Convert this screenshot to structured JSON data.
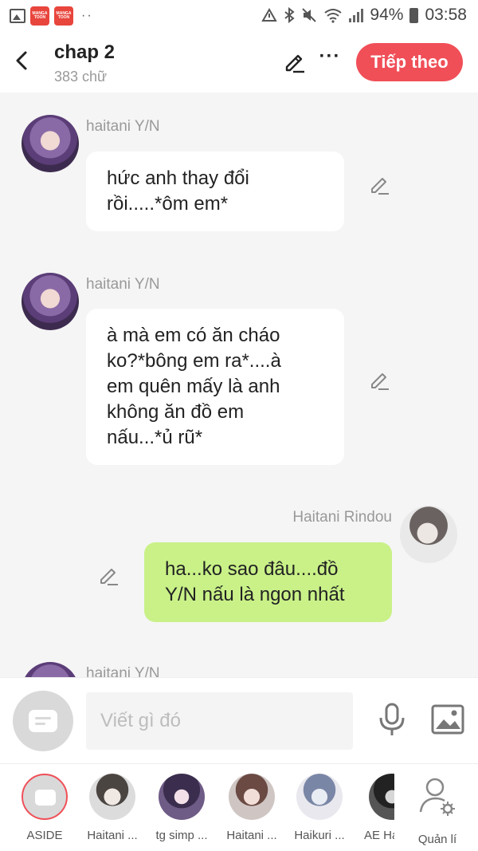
{
  "status_bar": {
    "app_icon_text": "MANGA TOON",
    "dots": "··",
    "battery": "94%",
    "time": "03:58"
  },
  "header": {
    "title": "chap 2",
    "subtitle": "383 chữ",
    "next_label": "Tiếp theo"
  },
  "messages": [
    {
      "side": "left",
      "sender": "haitani Y/N",
      "lines": [
        "hức anh thay đổi",
        "rồi.....*ôm em*"
      ]
    },
    {
      "side": "left",
      "sender": "haitani Y/N",
      "lines": [
        "à mà em có ăn cháo",
        "ko?*bông em ra*....à",
        "em quên mấy là anh",
        "không ăn đồ em",
        "nấu...*ủ rũ*"
      ]
    },
    {
      "side": "right",
      "sender": "Haitani Rindou",
      "lines": [
        "ha...ko sao đâu....đồ",
        "Y/N nấu là ngon nhất"
      ]
    },
    {
      "side": "left",
      "sender": "haitani Y/N",
      "lines": []
    }
  ],
  "input": {
    "placeholder": "Viết gì đó"
  },
  "characters": [
    {
      "label": "ASIDE"
    },
    {
      "label": "Haitani ..."
    },
    {
      "label": "tg simp ..."
    },
    {
      "label": "Haitani ..."
    },
    {
      "label": "Haikuri ..."
    },
    {
      "label": "AE Ha"
    },
    {
      "label": "Quản lí"
    }
  ],
  "colors": {
    "accent": "#f04f58",
    "bubble_self": "#c9f188",
    "bubble_other": "#ffffff",
    "background": "#f5f5f5"
  }
}
